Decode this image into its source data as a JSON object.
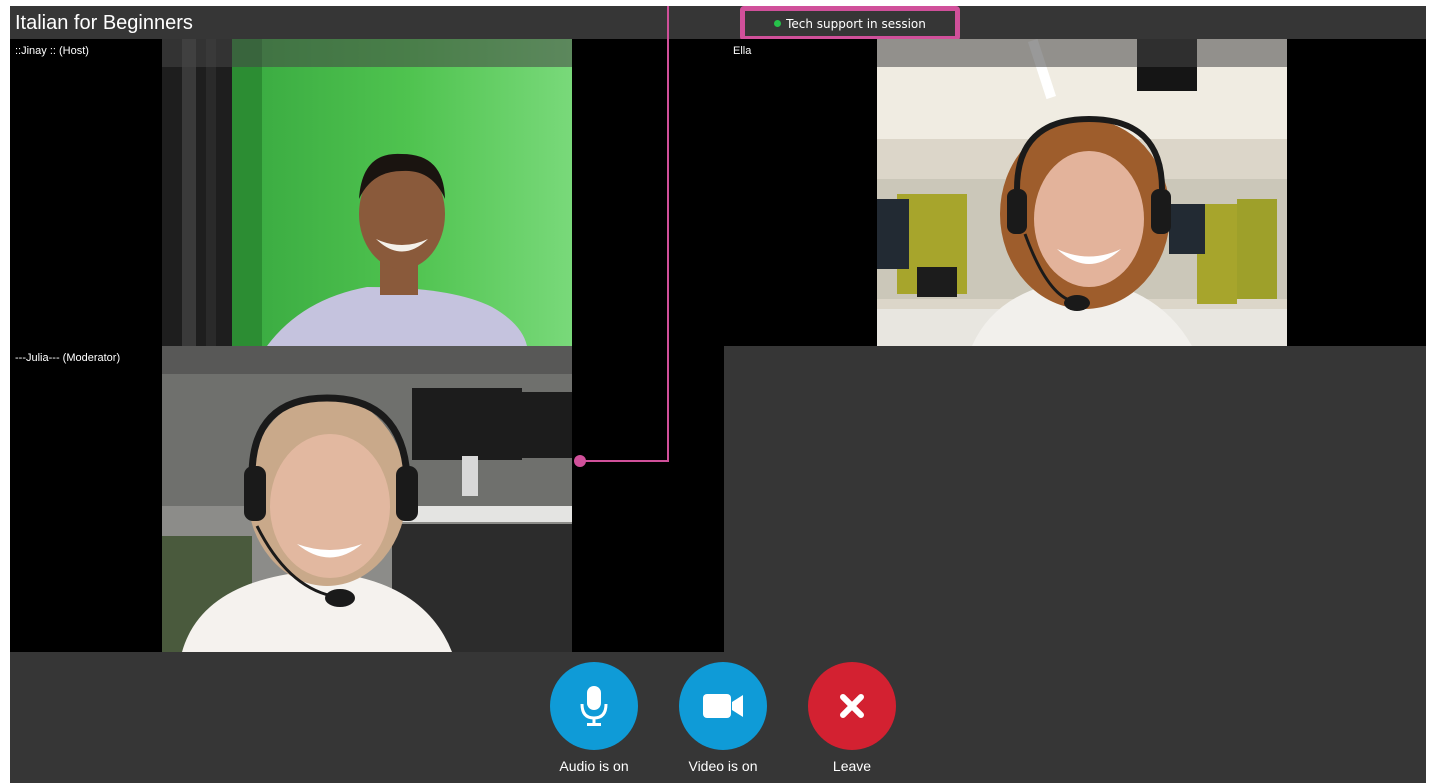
{
  "app": {
    "title": "Italian for Beginners"
  },
  "status": {
    "text": "Tech support in session",
    "dot_color": "#26c24a",
    "highlight_color": "#d0509a"
  },
  "participants": [
    {
      "name": "::Jinay :: (Host)"
    },
    {
      "name": "Ella"
    },
    {
      "name": "---Julia--- (Moderator)"
    }
  ],
  "controls": {
    "audio": {
      "label": "Audio is on",
      "icon": "microphone-icon",
      "color": "#0f9bd7"
    },
    "video": {
      "label": "Video is on",
      "icon": "video-camera-icon",
      "color": "#0f9bd7"
    },
    "leave": {
      "label": "Leave",
      "icon": "close-icon",
      "color": "#d32131"
    }
  }
}
